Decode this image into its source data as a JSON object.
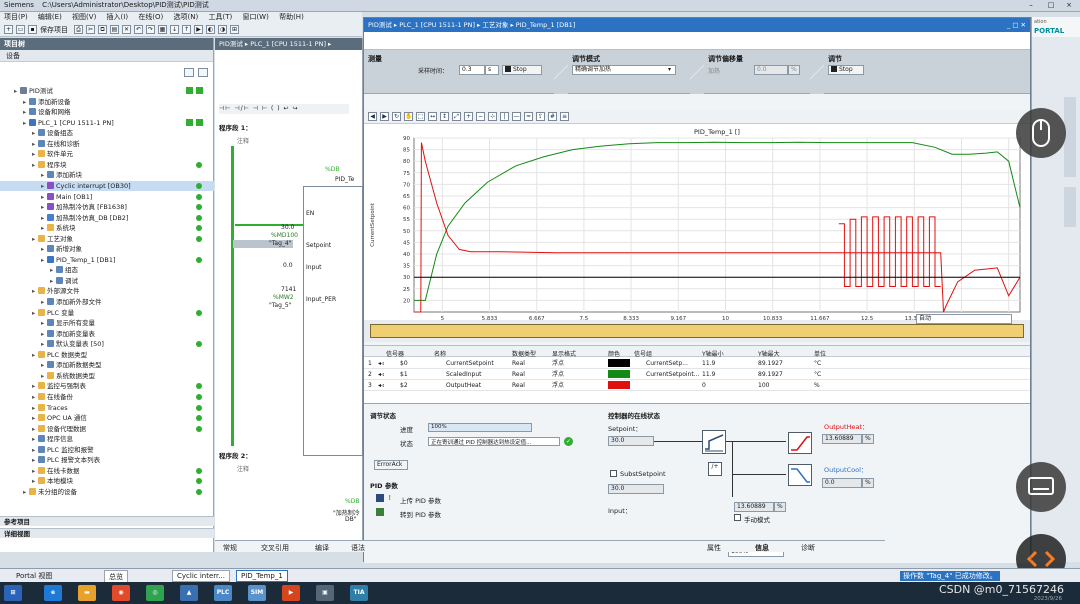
{
  "titlebar": {
    "app": "Siemens",
    "path": "C:\\Users\\Administrator\\Desktop\\PID测试\\PID测试"
  },
  "menu": [
    "项目(P)",
    "编辑(E)",
    "视图(V)",
    "插入(I)",
    "在线(O)",
    "选项(N)",
    "工具(T)",
    "窗口(W)",
    "帮助(H)"
  ],
  "toolbar": {
    "save": "保存项目"
  },
  "tree": {
    "header": "项目树",
    "tab": "设备",
    "items": [
      {
        "text": "PID测试",
        "indent": 0,
        "icon": "project-icon",
        "chk": true
      },
      {
        "text": "添加新设备",
        "indent": 1,
        "icon": "add-device-icon"
      },
      {
        "text": "设备和网络",
        "indent": 1,
        "icon": "network-icon"
      },
      {
        "text": "PLC_1 [CPU 1511-1 PN]",
        "indent": 1,
        "icon": "cpu-icon",
        "chk": true
      },
      {
        "text": "设备组态",
        "indent": 2,
        "icon": "config-icon"
      },
      {
        "text": "在线和诊断",
        "indent": 2,
        "icon": "diagnostics-icon"
      },
      {
        "text": "软件单元",
        "indent": 2,
        "icon": "folder-icon"
      },
      {
        "text": "程序块",
        "indent": 2,
        "icon": "folder-icon",
        "dot": true
      },
      {
        "text": "添加新块",
        "indent": 3,
        "icon": "add-block-icon"
      },
      {
        "text": "Cyclic interrupt [OB30]",
        "indent": 3,
        "icon": "ob-icon",
        "dot": true,
        "sel": true
      },
      {
        "text": "Main [OB1]",
        "indent": 3,
        "icon": "ob-icon",
        "dot": true
      },
      {
        "text": "加热制冷仿真 [FB1638]",
        "indent": 3,
        "icon": "fb-icon",
        "dot": true
      },
      {
        "text": "加热制冷仿真_DB [DB2]",
        "indent": 3,
        "icon": "db-icon",
        "dot": true
      },
      {
        "text": "系统块",
        "indent": 3,
        "icon": "folder-icon",
        "dot": true
      },
      {
        "text": "工艺对象",
        "indent": 2,
        "icon": "folder-icon",
        "dot": true
      },
      {
        "text": "新增对象",
        "indent": 3,
        "icon": "add-object-icon"
      },
      {
        "text": "PID_Temp_1 [DB1]",
        "indent": 3,
        "icon": "pid-icon",
        "dot": true
      },
      {
        "text": "组态",
        "indent": 4,
        "icon": "config-icon"
      },
      {
        "text": "调试",
        "indent": 4,
        "icon": "commissioning-icon"
      },
      {
        "text": "外部源文件",
        "indent": 2,
        "icon": "folder-icon"
      },
      {
        "text": "添加新外部文件",
        "indent": 3,
        "icon": "add-file-icon"
      },
      {
        "text": "PLC 变量",
        "indent": 2,
        "icon": "folder-icon",
        "dot": true
      },
      {
        "text": "显示所有变量",
        "indent": 3,
        "icon": "tags-icon"
      },
      {
        "text": "添加新变量表",
        "indent": 3,
        "icon": "add-table-icon"
      },
      {
        "text": "默认变量表 [50]",
        "indent": 3,
        "icon": "tags-icon",
        "dot": true
      },
      {
        "text": "PLC 数据类型",
        "indent": 2,
        "icon": "folder-icon"
      },
      {
        "text": "添加新数据类型",
        "indent": 3,
        "icon": "add-type-icon"
      },
      {
        "text": "系统数据类型",
        "indent": 3,
        "icon": "folder-icon"
      },
      {
        "text": "监控与强制表",
        "indent": 2,
        "icon": "folder-icon",
        "dot": true
      },
      {
        "text": "在线备份",
        "indent": 2,
        "icon": "folder-icon",
        "dot": true
      },
      {
        "text": "Traces",
        "indent": 2,
        "icon": "folder-icon",
        "dot": true
      },
      {
        "text": "OPC UA 通信",
        "indent": 2,
        "icon": "folder-icon",
        "dot": true
      },
      {
        "text": "设备代理数据",
        "indent": 2,
        "icon": "folder-icon",
        "dot": true
      },
      {
        "text": "程序信息",
        "indent": 2,
        "icon": "info-icon"
      },
      {
        "text": "PLC 监控和报警",
        "indent": 2,
        "icon": "alarm-icon"
      },
      {
        "text": "PLC 报警文本列表",
        "indent": 2,
        "icon": "list-icon"
      },
      {
        "text": "在线卡数据",
        "indent": 2,
        "icon": "folder-icon",
        "dot": true
      },
      {
        "text": "本地模块",
        "indent": 2,
        "icon": "folder-icon",
        "dot": true
      },
      {
        "text": "未分组的设备",
        "indent": 1,
        "icon": "folder-icon",
        "dot": true
      }
    ],
    "ref_projects": "参考项目",
    "details": "详细视图"
  },
  "editor": {
    "breadcrumb": "PID测试 ▸ PLC_1 [CPU 1511-1 PN] ▸",
    "seg1": "程序段 1：",
    "seg2": "程序段 2：",
    "comment": "注释",
    "db_label": "%DB",
    "pid_title": "PID_Te",
    "en": "EN",
    "sp_val": "30.0",
    "sp_addr": "%MD100",
    "sp_tag": "\"Tag_4\"",
    "sp_pin": "Setpoint",
    "input_val": "0.0",
    "input_pin": "Input",
    "per_val": "7141",
    "per_addr": "%MW2",
    "per_tag": "\"Tag_5\"",
    "per_pin": "Input_PER",
    "db2_label": "%DB",
    "db2_name": "\"加热制冷",
    "db2_sub": "DB\""
  },
  "pid": {
    "breadcrumb": "PID测试 ▸ PLC_1 [CPU 1511-1 PN] ▸ 工艺对象 ▸ PID_Temp_1 [DB1]",
    "measure": {
      "title": "测量",
      "sample_label": "采样时间：",
      "sample_value": "0.3",
      "unit": "s",
      "stop": "Stop"
    },
    "mode": {
      "title": "调节模式",
      "value": "精确调节加热"
    },
    "offset": {
      "title": "调节偏移量",
      "label": "加热",
      "value": "0.0",
      "unit": "%"
    },
    "tune": {
      "title": "调节",
      "stop": "Stop"
    },
    "chart_title": "PID_Temp_1 []",
    "xunit": "[min]",
    "auto": "自动",
    "columns": [
      "信号器",
      "名称",
      "数据类型",
      "显示格式",
      "颜色",
      "信号组",
      "Y轴最小",
      "Y轴最大",
      "单位"
    ],
    "signals": [
      {
        "idx": "1",
        "addr": "$0",
        "name": "CurrentSetpoint",
        "type": "Real",
        "fmt": "浮点",
        "color": "#000000",
        "group": "CurrentSetp...",
        "ymin": "11.9",
        "ymax": "89.1927",
        "unit": "°C"
      },
      {
        "idx": "2",
        "addr": "$1",
        "name": "ScaledInput",
        "type": "Real",
        "fmt": "浮点",
        "color": "#138a13",
        "group": "CurrentSetpoint...",
        "ymin": "11.9",
        "ymax": "89.1927",
        "unit": "°C"
      },
      {
        "idx": "3",
        "addr": "$2",
        "name": "OutputHeat",
        "type": "Real",
        "fmt": "浮点",
        "color": "#e01010",
        "group": "",
        "ymin": "0",
        "ymax": "100",
        "unit": "%"
      }
    ],
    "status": {
      "title": "调节状态",
      "progress_label": "进度",
      "progress_value": "100%",
      "progress_fraction": 1.0,
      "state_label": "状态",
      "state_value": "正在寄训通过 PID 控制器达到热设定值...",
      "erroack": "ErrorAck"
    },
    "params": {
      "title": "PID 参数",
      "upload": "上传 PID 参数",
      "goto": "转到 PID 参数"
    },
    "online": {
      "title": "控制器的在线状态",
      "setpoint_label": "Setpoint：",
      "setpoint_value": "30.0",
      "subst_label": "SubstSetpoint",
      "subst_value": "30.0",
      "input_label": "Input：",
      "mid_value": "13.60889",
      "mid_unit": "%",
      "manual": "手动模式",
      "heat_label": "OutputHeat：",
      "heat_value": "13.60889",
      "heat_unit": "%",
      "cool_label": "OutputCool：",
      "cool_value": "0.0",
      "cool_unit": "%"
    }
  },
  "bottom": {
    "tabs": [
      "常规",
      "交叉引用",
      "编译",
      "语法"
    ],
    "zoom": "100%",
    "props": "属性",
    "info": "信息",
    "diag": "诊断"
  },
  "portal": {
    "label": "Portal 视图",
    "tabs": [
      "总览",
      "Cyclic interr...",
      "PID_Temp_1"
    ],
    "status": "操作数 \"Tag_4\" 已成功修改。"
  },
  "right": {
    "brand1": "Totally Integrated Automation",
    "brand2": "PORTAL",
    "brand2_short": "ation",
    "brand2_main": "PORTAL"
  },
  "taskbar": {
    "watermark": "CSDN @m0_71567246",
    "date": "2023/9/26"
  },
  "chart_data": {
    "type": "line",
    "title": "PID_Temp_1 []",
    "xlabel": "[min]",
    "ylabel": "CurrentSetpoint",
    "x_ticks": [
      "5",
      "5.833",
      "6.667",
      "7.5",
      "8.333",
      "9.167",
      "10",
      "10.833",
      "11.667",
      "12.5",
      "13.333",
      "14.167",
      "15"
    ],
    "y_ticks": [
      20,
      25,
      30,
      35,
      40,
      45,
      50,
      55,
      60,
      65,
      70,
      75,
      80,
      85,
      90
    ],
    "xlim": [
      4.5,
      15.2
    ],
    "ylim": [
      15,
      90
    ],
    "series": [
      {
        "name": "ScaledInput",
        "color": "#138a13",
        "x": [
          4.5,
          4.7,
          4.9,
          5.1,
          5.4,
          5.8,
          6.3,
          6.8,
          7.3,
          7.8,
          8.3,
          8.8,
          9.3,
          9.8,
          10.3,
          10.8,
          11.3,
          11.8,
          12.3,
          12.8,
          13.3,
          13.7,
          14.0,
          14.3,
          14.6,
          14.8,
          15.0,
          15.1,
          15.2
        ],
        "y": [
          20,
          20,
          40,
          52,
          62,
          71,
          78,
          82,
          85,
          86.5,
          87.5,
          88,
          88,
          88.2,
          88,
          88,
          88.2,
          88,
          88,
          88,
          88,
          86,
          83,
          83,
          83.5,
          84,
          80,
          70,
          60
        ]
      },
      {
        "name": "OutputHeat",
        "color": "#e01010",
        "x": [
          4.5,
          4.62,
          4.63,
          4.7,
          4.9,
          5.1,
          5.3,
          5.5,
          6.0,
          7.0,
          8.0,
          9.0,
          10.0,
          11.0,
          12.0,
          12.8,
          13.3,
          13.6,
          13.8,
          13.85,
          13.9,
          14.1,
          14.4,
          14.8,
          15.0,
          15.2
        ],
        "y": [
          15,
          15,
          88,
          80,
          62,
          48,
          42,
          41,
          41,
          40.5,
          40.5,
          40.5,
          40.5,
          40.5,
          40.5,
          40.5,
          40.5,
          40.5,
          40.5,
          15,
          18,
          28,
          33,
          34,
          22,
          30
        ]
      },
      {
        "name": "OutputHeat_oscillation",
        "color": "#e01010",
        "x": [
          12.0,
          12.1,
          12.1,
          12.2,
          12.2,
          12.3,
          12.3,
          12.4,
          12.4,
          12.5,
          12.5,
          12.6,
          12.6,
          12.7,
          12.7,
          12.8,
          12.8,
          12.9,
          12.9,
          13.0,
          13.0,
          13.1,
          13.1,
          13.2,
          13.2,
          13.3,
          13.3,
          13.4,
          13.4,
          13.5,
          13.5,
          13.6,
          13.6,
          13.7,
          13.7,
          13.8
        ],
        "y": [
          53,
          53,
          26,
          26,
          55,
          55,
          26,
          26,
          56,
          56,
          26,
          26,
          56,
          56,
          26,
          26,
          56,
          56,
          26,
          26,
          56,
          56,
          26,
          26,
          56,
          56,
          26,
          26,
          56,
          56,
          26,
          26,
          56,
          56,
          26,
          26
        ]
      },
      {
        "name": "CurrentSetpoint",
        "color": "#000000",
        "x": [
          4.5,
          15.2
        ],
        "y": [
          30,
          30
        ]
      }
    ]
  }
}
